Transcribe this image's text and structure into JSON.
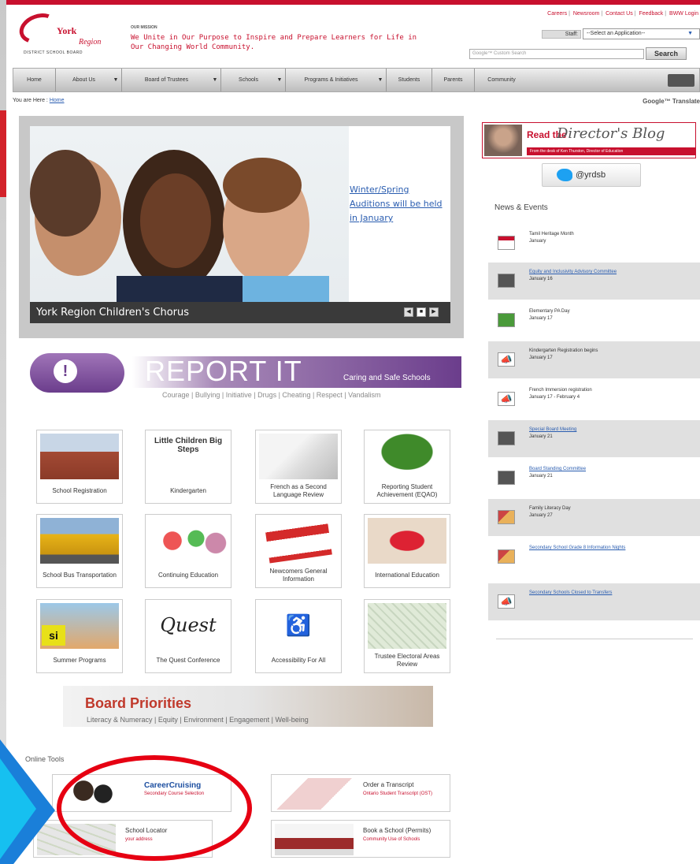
{
  "header": {
    "logo_york": "York",
    "logo_region": "Region",
    "logo_dsb": "DISTRICT SCHOOL BOARD",
    "mission_label": "OUR MISSION",
    "mission_text": "We Unite in Our Purpose to Inspire and Prepare Learners for Life in Our Changing World Community.",
    "top_links": [
      "Careers",
      "Newsroom",
      "Contact Us",
      "Feedback",
      "BWW Login"
    ],
    "staff_label": "Staff:",
    "app_select": "--Select an Application--",
    "search_placeholder": "Google™ Custom Search",
    "search_button": "Search"
  },
  "nav": {
    "items": [
      "Home",
      "About Us",
      "Board of Trustees",
      "Schools",
      "Programs & Initiatives",
      "Students",
      "Parents",
      "Community"
    ]
  },
  "breadcrumb": {
    "prefix": "You are Here :",
    "home": "Home"
  },
  "google_translate": "Google™ Translate",
  "hero": {
    "caption": "York Region Children's Chorus",
    "note": "Winter/Spring Auditions will be held in January"
  },
  "report_it": {
    "title": "REPORT IT",
    "subtitle": "Caring and Safe Schools",
    "tagline": "Courage | Bullying | Initiative | Drugs | Cheating | Respect | Vandalism"
  },
  "tiles": [
    {
      "label": "School Registration"
    },
    {
      "label": "Kindergarten",
      "art": "Little Children Big Steps"
    },
    {
      "label": "French as a Second Language Review"
    },
    {
      "label": "Reporting Student Achievement (EQAO)"
    },
    {
      "label": "School Bus Transportation"
    },
    {
      "label": "Continuing Education"
    },
    {
      "label": "Newcomers General Information"
    },
    {
      "label": "International Education"
    },
    {
      "label": "Summer Programs",
      "art": "si"
    },
    {
      "label": "The Quest Conference",
      "art": "Quest"
    },
    {
      "label": "Accessibility For All"
    },
    {
      "label": "Trustee Electoral Areas Review"
    }
  ],
  "board_priorities": {
    "title": "Board Priorities",
    "subtitle": "Literacy & Numeracy | Equity | Environment | Engagement | Well-being"
  },
  "online_tools": {
    "heading": "Online Tools",
    "items": [
      {
        "title": "CareerCruising",
        "sub": "Secondary Course Selection"
      },
      {
        "title": "Order a Transcript",
        "sub": "Ontario Student Transcript (OST)"
      },
      {
        "title": "School Locator",
        "sub": "your address"
      },
      {
        "title": "Book a School (Permits)",
        "sub": "Community Use of Schools"
      }
    ]
  },
  "blog": {
    "read": "Read the",
    "title": "Director's Blog",
    "strip": "From the desk of Ken Thurston, Director of Education"
  },
  "twitter": {
    "handle": "@yrdsb"
  },
  "news": {
    "heading": "News & Events",
    "items": [
      {
        "title": "Tamil Heritage Month",
        "date": "January",
        "link": false
      },
      {
        "title": "Equity and Inclusivity Advisory Committee",
        "date": "January 16",
        "link": true
      },
      {
        "title": "Elementary PA Day",
        "date": "January 17",
        "link": false
      },
      {
        "title": "Kindergarten Registration begins",
        "date": "January 17",
        "link": false
      },
      {
        "title": "French Immersion registration",
        "date": "January 17 - February 4",
        "link": false
      },
      {
        "title": "Special Board Meeting",
        "date": "January 21",
        "link": true
      },
      {
        "title": "Board Standing Committee",
        "date": "January 21",
        "link": true
      },
      {
        "title": "Family Literacy Day",
        "date": "January 27",
        "link": false
      },
      {
        "title": "Secondary School Grade 8 Information Nights",
        "date": "",
        "link": true
      },
      {
        "title": "Secondary Schools Closed to Transfers",
        "date": "",
        "link": true
      }
    ]
  },
  "colors": {
    "brand": "#c8102e",
    "link": "#2a5db0",
    "annotation": "#e60012",
    "arrow": "#1a7fd9"
  }
}
